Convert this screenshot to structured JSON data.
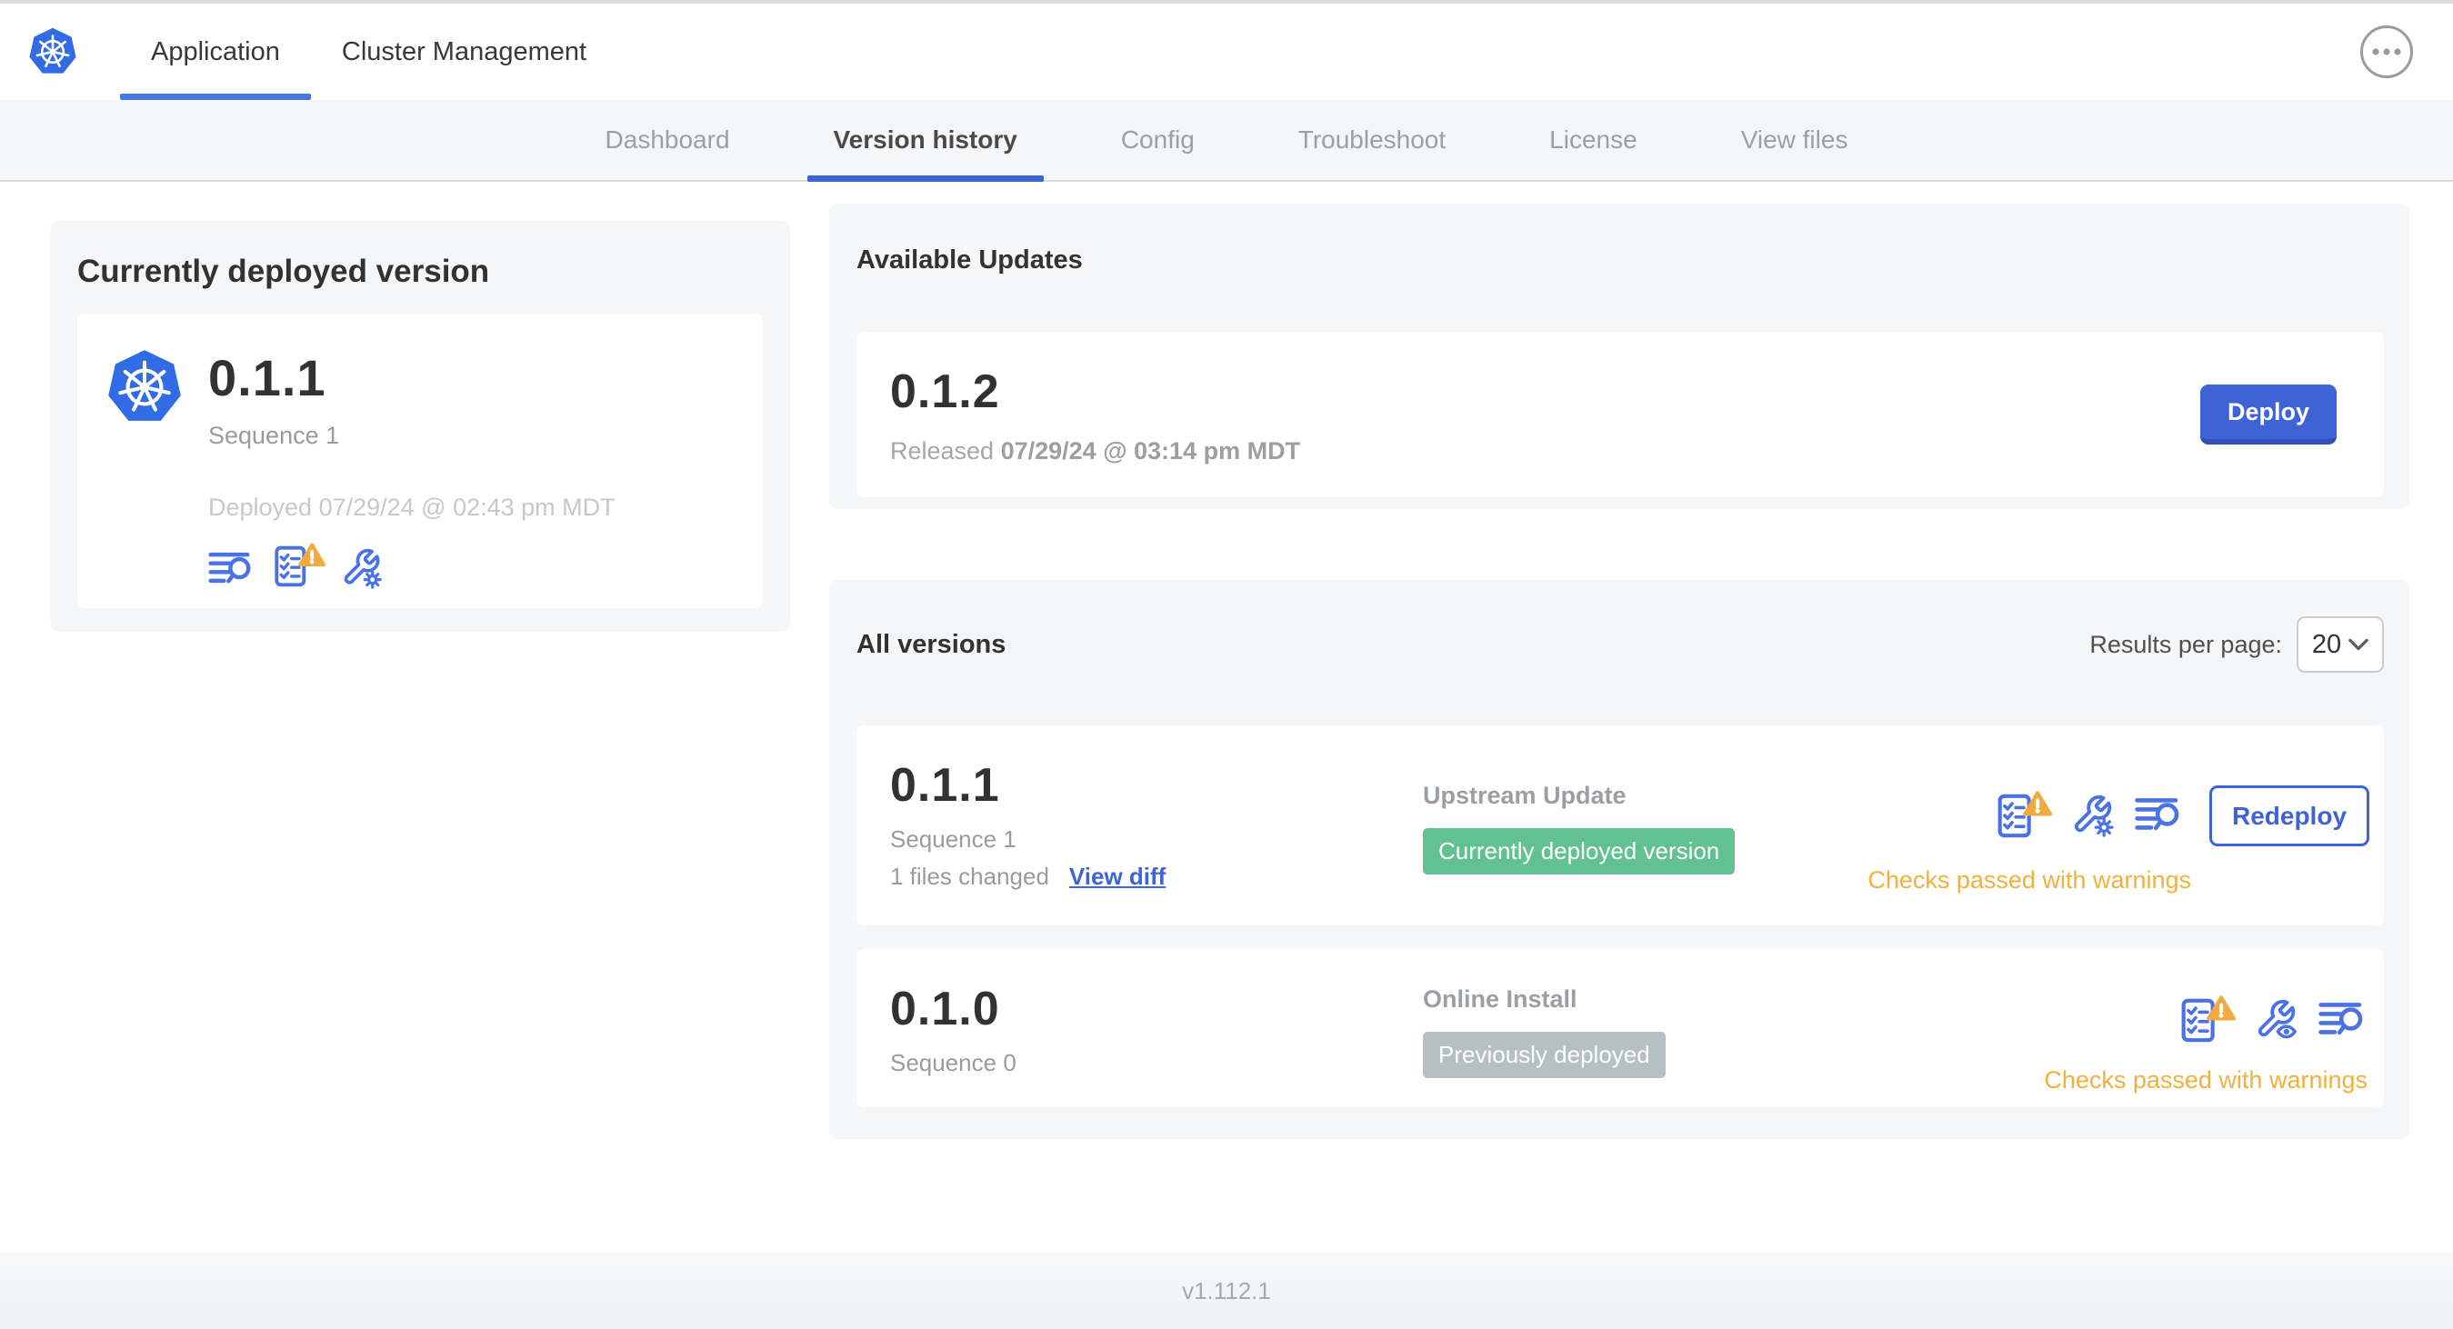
{
  "colors": {
    "primary_blue": "#3e63d6",
    "icon_blue": "#4a72e5",
    "warning_amber": "#f0ad3f",
    "success_green": "#61c190",
    "muted_badge_gray": "#b5c0c5"
  },
  "header": {
    "tabs": [
      {
        "label": "Application"
      },
      {
        "label": "Cluster Management"
      }
    ]
  },
  "nav": {
    "items": [
      {
        "label": "Dashboard"
      },
      {
        "label": "Version history"
      },
      {
        "label": "Config"
      },
      {
        "label": "Troubleshoot"
      },
      {
        "label": "License"
      },
      {
        "label": "View files"
      }
    ]
  },
  "current_version": {
    "title": "Currently deployed version",
    "version": "0.1.1",
    "sequence": "Sequence 1",
    "deployed": "Deployed 07/29/24 @ 02:43 pm MDT"
  },
  "available_updates": {
    "title": "Available Updates",
    "version": "0.1.2",
    "released_prefix": "Released",
    "released_date": "07/29/24 @ 03:14 pm MDT",
    "deploy_label": "Deploy"
  },
  "all_versions": {
    "title": "All versions",
    "results_per_page_label": "Results per page:",
    "results_per_page_value": "20",
    "rows": [
      {
        "version": "0.1.1",
        "sequence": "Sequence 1",
        "files_changed": "1 files changed",
        "view_diff": "View diff",
        "source": "Upstream Update",
        "badge": "Currently deployed version",
        "status": "Checks passed with warnings",
        "action": "Redeploy"
      },
      {
        "version": "0.1.0",
        "sequence": "Sequence 0",
        "source": "Online Install",
        "badge": "Previously deployed",
        "status": "Checks passed with warnings"
      }
    ]
  },
  "footer": {
    "version": "v1.112.1"
  }
}
